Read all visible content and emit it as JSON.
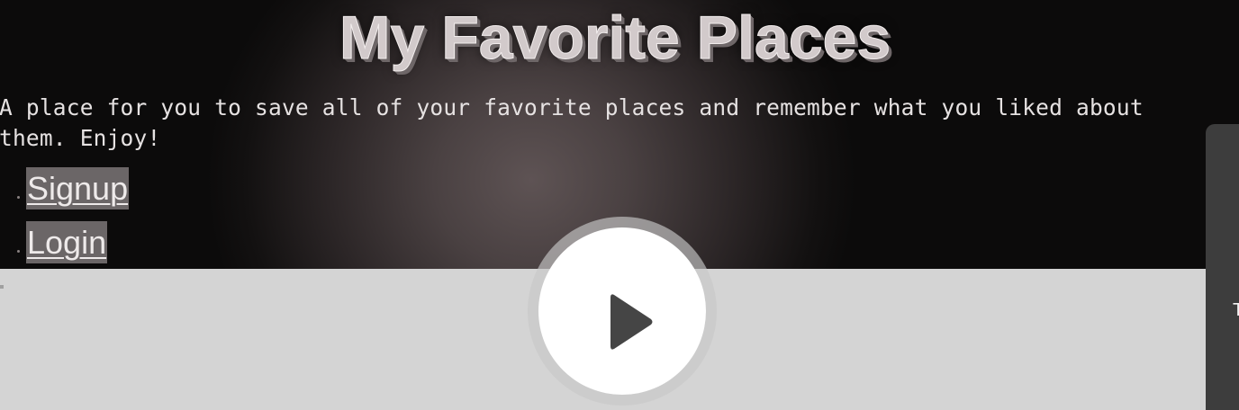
{
  "header": {
    "title": "My Favorite Places",
    "tagline": "A place for you to save all of your favorite places and remember what you liked about them. Enjoy!"
  },
  "nav": {
    "items": [
      {
        "label": "Signup"
      },
      {
        "label": "Login"
      }
    ]
  },
  "side_panel": {
    "glyph": "T"
  },
  "video_overlay": {
    "play_icon": "play-icon"
  },
  "colors": {
    "background": "#0c0b0b",
    "overlay": "#d4d4d4",
    "link_highlight": "#6b6667",
    "side_panel": "#3d3d3d"
  }
}
